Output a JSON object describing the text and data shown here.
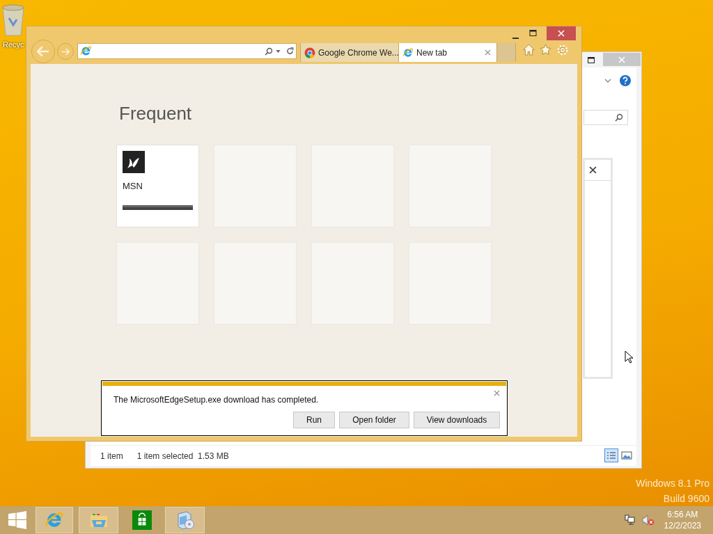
{
  "desktop": {
    "icons": [
      {
        "label": "Recyc"
      }
    ],
    "edition": [
      "Windows 8.1 Pro",
      "Build 9600"
    ]
  },
  "explorer_window": {
    "status_bar": {
      "item_count": "1 item",
      "selection": "1 item selected  1.53 MB"
    }
  },
  "browser": {
    "tabs": [
      {
        "title": "Google Chrome We...",
        "kind": "chrome",
        "selected": false
      },
      {
        "title": "New tab",
        "kind": "ie",
        "selected": true
      }
    ]
  },
  "new_tab_page": {
    "heading": "Frequent",
    "tiles": [
      {
        "kind": "site",
        "label": "MSN"
      },
      {
        "kind": "empty"
      },
      {
        "kind": "empty"
      },
      {
        "kind": "empty"
      },
      {
        "kind": "empty"
      },
      {
        "kind": "empty"
      },
      {
        "kind": "empty"
      },
      {
        "kind": "empty"
      }
    ]
  },
  "download_bar": {
    "message": "The MicrosoftEdgeSetup.exe download has completed.",
    "buttons": [
      "Run",
      "Open folder",
      "View downloads"
    ]
  },
  "taskbar": {
    "apps": [
      {
        "kind": "ie",
        "running": true
      },
      {
        "kind": "explorer",
        "running": true
      },
      {
        "kind": "store",
        "running": false
      },
      {
        "kind": "installer",
        "running": true
      }
    ],
    "clock": {
      "time": "6:56 AM",
      "date": "12/2/2023"
    }
  }
}
